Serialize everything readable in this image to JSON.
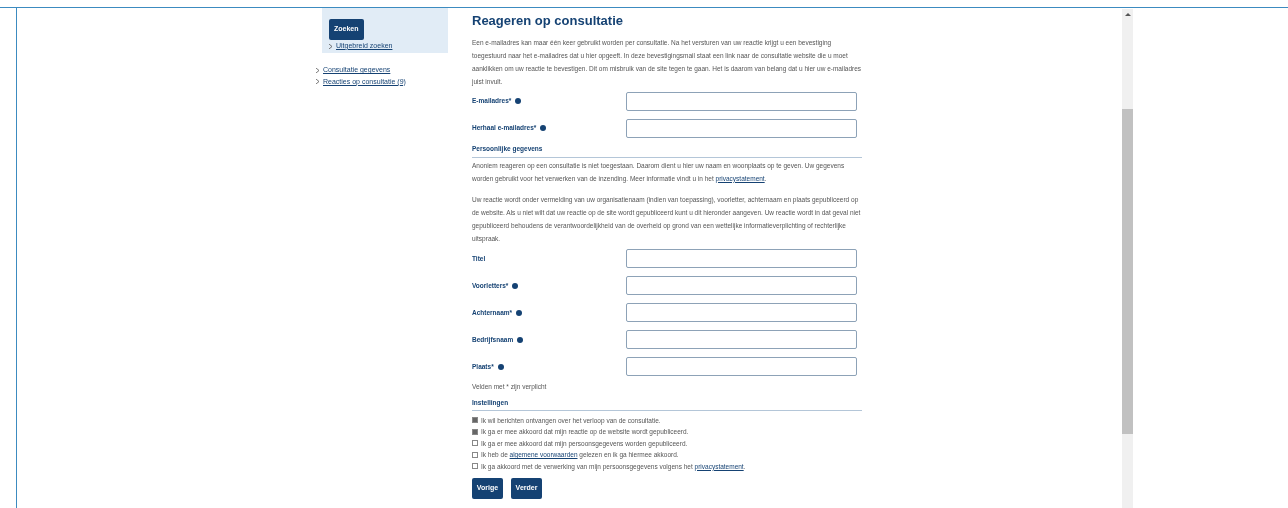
{
  "sidebar": {
    "search_button": "Zoeken",
    "advanced_link": "Uitgebreid zoeken",
    "links": [
      "Consultatie gegevens",
      "Reacties op consultatie (9)"
    ]
  },
  "main": {
    "title": "Reageren op consultatie",
    "intro": [
      {
        "kind": "text",
        "text": "Een e-mailadres kan maar één keer gebruikt worden per consultatie. Na het versturen van uw reactie krijgt u een bevestiging toegestuurd naar het e-mailadres dat u hier opgeeft. In deze bevestigingsmail staat een link naar de consultatie website die u moet aanklikken om uw reactie te bevestigen. Dit om misbruik van de site tegen te gaan. Het is daarom van belang dat u hier uw e-mailadres juist invult."
      }
    ],
    "email_fields": [
      {
        "label": "E-mailadres*",
        "help": true
      },
      {
        "label": "Herhaal e-mailadres*",
        "help": true
      }
    ],
    "personal": {
      "heading": "Persoonlijke gegevens",
      "paragraphs": [
        [
          {
            "kind": "text",
            "text": "Anoniem reageren op een consultatie is niet toegestaan. Daarom dient u hier uw naam en woonplaats op te geven. Uw gegevens worden gebruikt voor het verwerken van de inzending. Meer informatie vindt u in het "
          },
          {
            "kind": "link",
            "text": "privacystatement"
          },
          {
            "kind": "text",
            "text": "."
          }
        ],
        [
          {
            "kind": "text",
            "text": "Uw reactie wordt onder vermelding van uw organisatienaam (indien van toepassing), voorletter, achternaam en plaats gepubliceerd op de website. Als u niet wilt dat uw reactie op de site wordt gepubliceerd kunt u dit hieronder aangeven. Uw reactie wordt in dat geval niet gepubliceerd behoudens de verantwoordelijkheid van de overheid op grond van een wettelijke informatieverplichting of rechterlijke uitspraak."
          }
        ]
      ],
      "fields": [
        {
          "label": "Titel",
          "help": false
        },
        {
          "label": "Voorletters*",
          "help": true
        },
        {
          "label": "Achternaam*",
          "help": true
        },
        {
          "label": "Bedrijfsnaam",
          "help": true
        },
        {
          "label": "Plaats*",
          "help": true
        }
      ],
      "required_note": "Velden met * zijn verplicht"
    },
    "settings": {
      "heading": "Instellingen",
      "options": [
        {
          "checked": true,
          "parts": [
            {
              "kind": "text",
              "text": "Ik wil berichten ontvangen over het verloop van de consultatie."
            }
          ]
        },
        {
          "checked": true,
          "parts": [
            {
              "kind": "text",
              "text": "Ik ga er mee akkoord dat mijn reactie op de website wordt gepubliceerd."
            }
          ]
        },
        {
          "checked": false,
          "parts": [
            {
              "kind": "text",
              "text": "Ik ga er mee akkoord dat mijn persoonsgegevens worden gepubliceerd."
            }
          ]
        },
        {
          "checked": false,
          "parts": [
            {
              "kind": "text",
              "text": "Ik heb de "
            },
            {
              "kind": "link",
              "text": "algemene voorwaarden"
            },
            {
              "kind": "text",
              "text": " gelezen en ik ga hiermee akkoord."
            }
          ]
        },
        {
          "checked": false,
          "parts": [
            {
              "kind": "text",
              "text": "Ik ga akkoord met de verwerking van mijn persoonsgegevens volgens het "
            },
            {
              "kind": "link",
              "text": "privacystatement"
            },
            {
              "kind": "text",
              "text": "."
            }
          ]
        }
      ]
    },
    "buttons": [
      "Vorige",
      "Verder"
    ]
  }
}
